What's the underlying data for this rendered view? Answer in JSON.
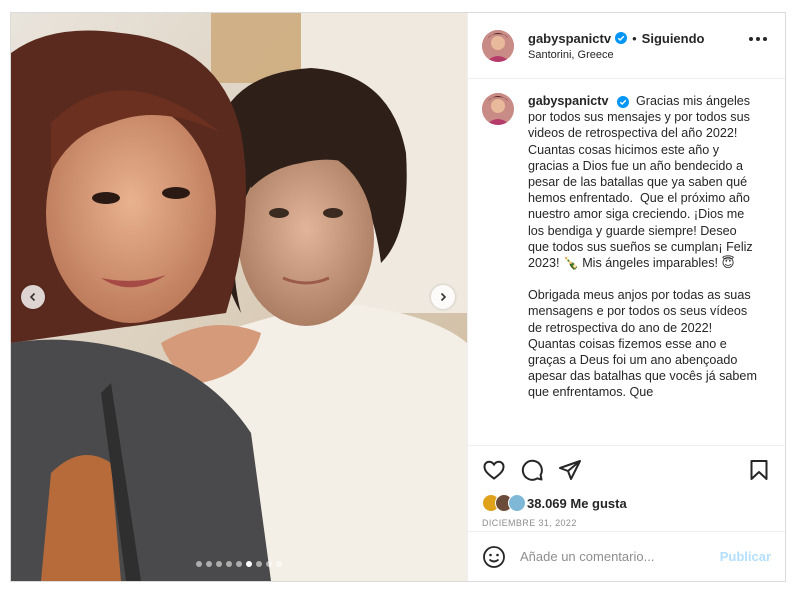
{
  "header": {
    "username": "gabyspanictv",
    "separator": "•",
    "follow_label": "Siguiendo",
    "location": "Santorini, Greece"
  },
  "caption": {
    "username": "gabyspanictv",
    "paragraph_es": "Gracias mis ángeles por todos sus mensajes y por todos sus videos de retrospectiva del año 2022! Cuantas cosas hicimos este año y gracias a Dios fue un año bendecido a pesar de las batallas que ya saben qué hemos enfrentado.  Que el próximo año nuestro amor siga creciendo. ¡Dios me los bendiga y guarde siempre! Deseo que todos sus sueños se cumplan¡ Feliz 2023! 🍾 Mis ángeles imparables! 😇",
    "paragraph_pt": "Obrigada meus anjos por todas as suas mensagens e por todos os seus vídeos de retrospectiva do ano de 2022! Quantas coisas fizemos esse ano e graças a Deus foi um ano abençoado apesar das batalhas que vocês já sabem que enfrentamos. Que"
  },
  "engagement": {
    "likes_text": "38.069 Me gusta",
    "date": "DICIEMBRE 31, 2022"
  },
  "comment": {
    "placeholder": "Añade un comentario...",
    "publish_label": "Publicar"
  },
  "carousel": {
    "total": 9,
    "active_index": 5
  },
  "icons": {
    "like": "heart-icon",
    "comment": "comment-icon",
    "share": "send-icon",
    "save": "bookmark-icon",
    "emoji": "emoji-icon",
    "more": "more-options-icon",
    "verified": "verified-badge-icon"
  },
  "colors": {
    "verified_blue": "#0095f6",
    "publish_disabled": "#b2dffc",
    "text": "#262626",
    "muted": "#8e8e8e"
  }
}
